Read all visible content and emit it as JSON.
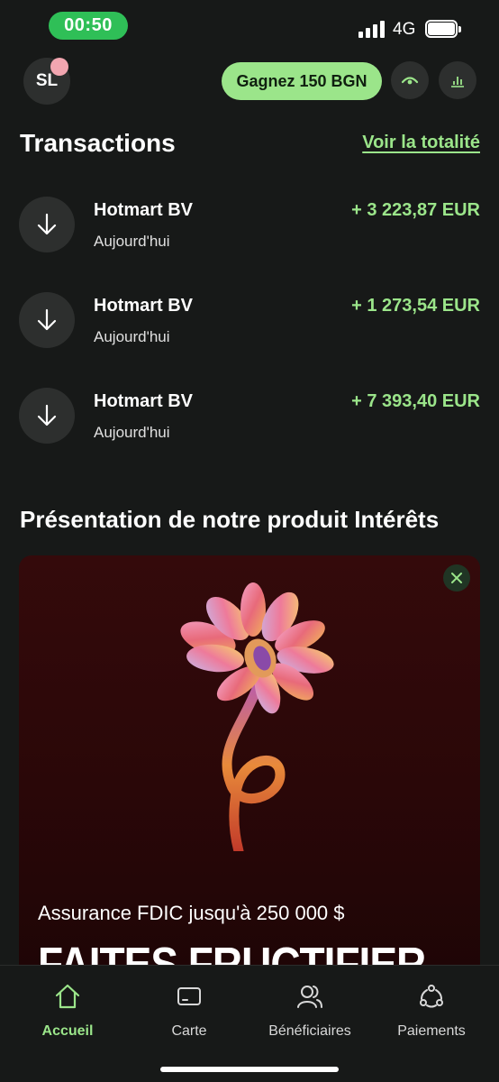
{
  "status_bar": {
    "time": "00:50",
    "network": "4G"
  },
  "header": {
    "avatar_initials": "SL",
    "promo_label": "Gagnez 150 BGN",
    "icons": [
      "eye-closed-icon",
      "bar-chart-icon"
    ]
  },
  "transactions": {
    "title": "Transactions",
    "see_all_label": "Voir la totalité",
    "items": [
      {
        "name": "Hotmart BV",
        "date": "Aujourd'hui",
        "amount": "+ 3 223,87 EUR",
        "icon": "arrow-down-icon"
      },
      {
        "name": "Hotmart BV",
        "date": "Aujourd'hui",
        "amount": "+ 1 273,54 EUR",
        "icon": "arrow-down-icon"
      },
      {
        "name": "Hotmart BV",
        "date": "Aujourd'hui",
        "amount": "+ 7 393,40 EUR",
        "icon": "arrow-down-icon"
      }
    ]
  },
  "promo": {
    "section_title": "Présentation de notre produit Intérêts",
    "subtitle": "Assurance FDIC jusqu'à 250 000 $",
    "headline": "FAITES FRUCTIFIER"
  },
  "bottom_nav": {
    "items": [
      {
        "label": "Accueil",
        "icon": "home-icon",
        "active": true
      },
      {
        "label": "Carte",
        "icon": "card-icon",
        "active": false
      },
      {
        "label": "Bénéficiaires",
        "icon": "users-icon",
        "active": false
      },
      {
        "label": "Paiements",
        "icon": "payments-icon",
        "active": false
      }
    ]
  },
  "colors": {
    "background": "#171918",
    "accent": "#9be58a",
    "time_pill": "#2fbf57",
    "card_background": "#340a0b"
  }
}
